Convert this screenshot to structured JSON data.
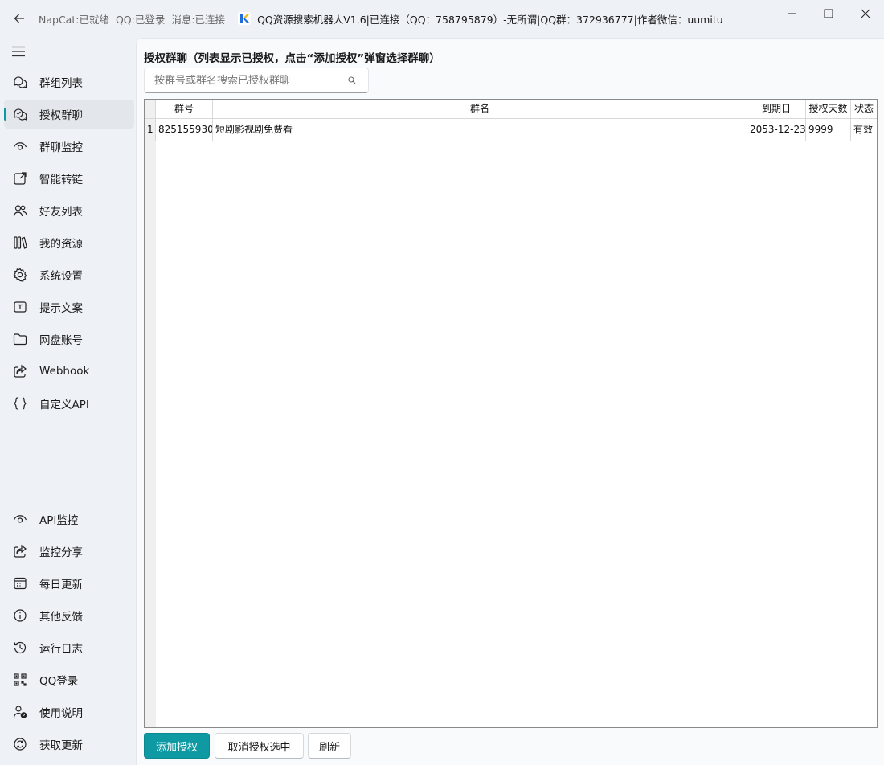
{
  "titlebar": {
    "napcat_status": "NapCat:已就绪",
    "qq_status": "QQ:已登录",
    "msg_status": "消息:已连接",
    "app_title": "QQ资源搜索机器人V1.6|已连接（QQ：758795879）-无所谓|QQ群：372936777|作者微信：uumitu"
  },
  "sidebar": {
    "top_items": [
      {
        "label": "群组列表",
        "icon": "chat-bubbles-icon"
      },
      {
        "label": "授权群聊",
        "icon": "chat-check-icon",
        "active": true
      },
      {
        "label": "群聊监控",
        "icon": "eye-icon"
      },
      {
        "label": "智能转链",
        "icon": "external-link-icon"
      },
      {
        "label": "好友列表",
        "icon": "people-icon"
      },
      {
        "label": "我的资源",
        "icon": "library-icon"
      },
      {
        "label": "系统设置",
        "icon": "gear-icon"
      },
      {
        "label": "提示文案",
        "icon": "text-box-icon"
      },
      {
        "label": "网盘账号",
        "icon": "folder-icon"
      },
      {
        "label": "Webhook",
        "icon": "share-icon"
      },
      {
        "label": "自定义API",
        "icon": "braces-icon"
      }
    ],
    "bottom_items": [
      {
        "label": "API监控",
        "icon": "eye-icon"
      },
      {
        "label": "监控分享",
        "icon": "share-icon"
      },
      {
        "label": "每日更新",
        "icon": "calendar-icon"
      },
      {
        "label": "其他反馈",
        "icon": "info-icon"
      },
      {
        "label": "运行日志",
        "icon": "history-icon"
      },
      {
        "label": "QQ登录",
        "icon": "qr-code-icon"
      },
      {
        "label": "使用说明",
        "icon": "person-question-icon"
      },
      {
        "label": "获取更新",
        "icon": "refresh-icon"
      }
    ]
  },
  "main": {
    "title": "授权群聊（列表显示已授权，点击“添加授权”弹窗选择群聊）",
    "search": {
      "placeholder": "按群号或群名搜索已授权群聊",
      "value": ""
    },
    "table": {
      "columns": [
        "群号",
        "群名",
        "到期日",
        "授权天数",
        "状态"
      ],
      "rows": [
        {
          "index": "1",
          "group_id": "825155930",
          "group_name": "短剧影视剧免费看",
          "expiry": "2053-12-23",
          "days": "9999",
          "status": "有效"
        }
      ]
    },
    "buttons": {
      "add": "添加授权",
      "cancel": "取消授权选中",
      "refresh": "刷新"
    }
  },
  "colors": {
    "accent": "#0f9aa3",
    "background": "#eef1f6",
    "panel": "#f9fafc"
  }
}
